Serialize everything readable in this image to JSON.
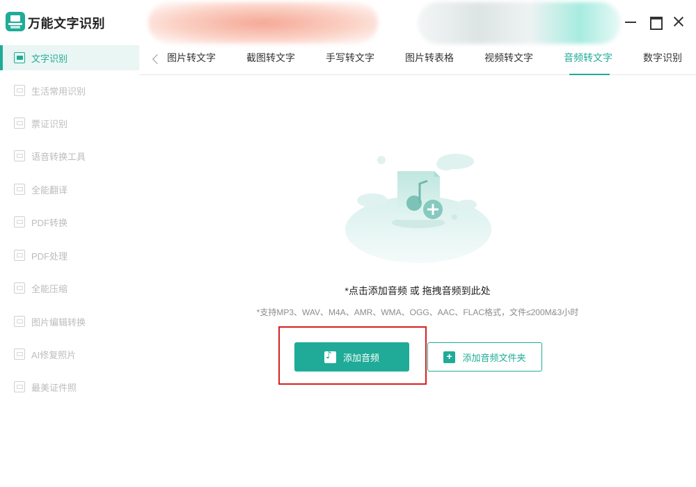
{
  "app": {
    "title": "万能文字识别"
  },
  "sidebar": {
    "items": [
      {
        "label": "文字识别",
        "active": true
      },
      {
        "label": "生活常用识别"
      },
      {
        "label": "票证识别"
      },
      {
        "label": "语音转换工具"
      },
      {
        "label": "全能翻译"
      },
      {
        "label": "PDF转换"
      },
      {
        "label": "PDF处理"
      },
      {
        "label": "全能压缩"
      },
      {
        "label": "图片编辑转换"
      },
      {
        "label": "AI修复照片"
      },
      {
        "label": "最美证件照"
      }
    ]
  },
  "tabs": {
    "items": [
      {
        "label": "图片转文字"
      },
      {
        "label": "截图转文字"
      },
      {
        "label": "手写转文字"
      },
      {
        "label": "图片转表格"
      },
      {
        "label": "视频转文字"
      },
      {
        "label": "音频转文字",
        "active": true
      },
      {
        "label": "数字识别"
      }
    ]
  },
  "main": {
    "drop_title": "*点击添加音频 或 拖拽音频到此处",
    "drop_subtitle": "*支持MP3、WAV、M4A、AMR、WMA、OGG、AAC、FLAC格式，文件≤200M&3小时",
    "add_audio_label": "添加音频",
    "add_folder_label": "添加音频文件夹"
  },
  "colors": {
    "accent": "#1fab97",
    "highlight": "#d71f1f"
  }
}
